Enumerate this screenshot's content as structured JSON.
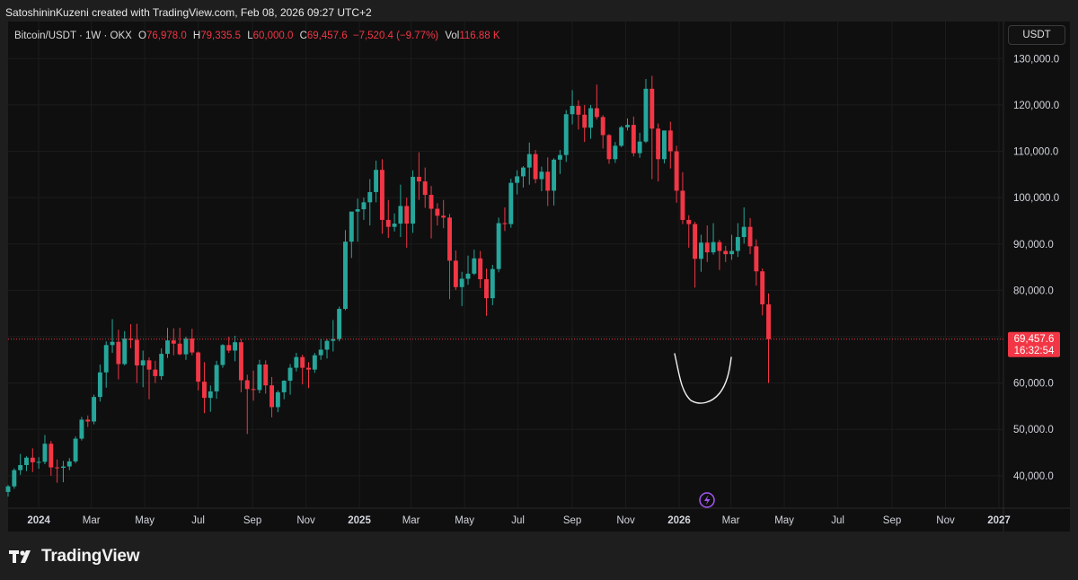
{
  "header": {
    "attribution": "SatoshininKuzeni created with TradingView.com, Feb 08, 2026 09:27 UTC+2"
  },
  "legend": {
    "symbol": "Bitcoin/USDT · 1W · OKX",
    "o_label": "O",
    "o_value": "76,978.0",
    "h_label": "H",
    "h_value": "79,335.5",
    "l_label": "L",
    "l_value": "60,000.0",
    "c_label": "C",
    "c_value": "69,457.6",
    "change": "−7,520.4 (−9.77%)",
    "vol_label": "Vol",
    "vol_value": "116.88 K"
  },
  "currency_button": "USDT",
  "price_tag": {
    "price": "69,457.6",
    "countdown": "16:32:54"
  },
  "footer": {
    "brand": "TradingView"
  },
  "colors": {
    "up": "#26a69a",
    "down": "#f23645",
    "text": "#d1d4dc",
    "grid": "#1c1c1c"
  },
  "chart_data": {
    "type": "candlestick",
    "ylim": [
      33000,
      138000
    ],
    "y_ticks": [
      {
        "value": 40000,
        "label": "40,000.0"
      },
      {
        "value": 50000,
        "label": "50,000.0"
      },
      {
        "value": 60000,
        "label": "60,000.0"
      },
      {
        "value": 70000,
        "label": "70,000.0"
      },
      {
        "value": 80000,
        "label": "80,000.0"
      },
      {
        "value": 90000,
        "label": "90,000.0"
      },
      {
        "value": 100000,
        "label": "100,000.0"
      },
      {
        "value": 110000,
        "label": "110,000.0"
      },
      {
        "value": 120000,
        "label": "120,000.0"
      },
      {
        "value": 130000,
        "label": "130,000.0"
      }
    ],
    "x_ticks": [
      {
        "date": "2024-01-01",
        "label": "2024",
        "bold": true
      },
      {
        "date": "2024-03-01",
        "label": "Mar"
      },
      {
        "date": "2024-05-01",
        "label": "May"
      },
      {
        "date": "2024-07-01",
        "label": "Jul"
      },
      {
        "date": "2024-09-01",
        "label": "Sep"
      },
      {
        "date": "2024-11-01",
        "label": "Nov"
      },
      {
        "date": "2025-01-01",
        "label": "2025",
        "bold": true
      },
      {
        "date": "2025-03-01",
        "label": "Mar"
      },
      {
        "date": "2025-05-01",
        "label": "May"
      },
      {
        "date": "2025-07-01",
        "label": "Jul"
      },
      {
        "date": "2025-09-01",
        "label": "Sep"
      },
      {
        "date": "2025-11-01",
        "label": "Nov"
      },
      {
        "date": "2026-01-01",
        "label": "2026",
        "bold": true
      },
      {
        "date": "2026-03-01",
        "label": "Mar"
      },
      {
        "date": "2026-05-01",
        "label": "May"
      },
      {
        "date": "2026-07-01",
        "label": "Jul"
      },
      {
        "date": "2026-09-01",
        "label": "Sep"
      },
      {
        "date": "2026-11-01",
        "label": "Nov"
      },
      {
        "date": "2027-01-01",
        "label": "2027",
        "bold": true
      }
    ],
    "first_week": "2023-11-27",
    "current_price": 69457.6,
    "ohlc": [
      [
        36500,
        38000,
        35500,
        37700
      ],
      [
        37700,
        41600,
        37200,
        41200
      ],
      [
        41200,
        44700,
        40200,
        42300
      ],
      [
        42300,
        44200,
        41000,
        43900
      ],
      [
        43900,
        45900,
        40800,
        42900
      ],
      [
        42900,
        44000,
        41500,
        43000
      ],
      [
        43000,
        48800,
        42500,
        46900
      ],
      [
        46900,
        47500,
        40000,
        41800
      ],
      [
        41800,
        43500,
        38500,
        41700
      ],
      [
        41700,
        43200,
        38600,
        42000
      ],
      [
        42000,
        43800,
        41200,
        43100
      ],
      [
        43100,
        48500,
        42700,
        48000
      ],
      [
        48000,
        52700,
        47600,
        52100
      ],
      [
        52100,
        53000,
        50500,
        51700
      ],
      [
        51700,
        57500,
        51100,
        57000
      ],
      [
        57000,
        64000,
        56000,
        62300
      ],
      [
        62300,
        69000,
        59000,
        68200
      ],
      [
        68200,
        73800,
        66500,
        68900
      ],
      [
        68900,
        71500,
        60800,
        64100
      ],
      [
        64100,
        71200,
        63800,
        69600
      ],
      [
        69600,
        72700,
        67500,
        69300
      ],
      [
        69300,
        72800,
        60000,
        63800
      ],
      [
        63800,
        67000,
        59100,
        64900
      ],
      [
        64900,
        65500,
        56500,
        62900
      ],
      [
        62900,
        64800,
        60000,
        61500
      ],
      [
        61500,
        67500,
        60700,
        66300
      ],
      [
        66300,
        71900,
        65400,
        69200
      ],
      [
        69200,
        71800,
        66000,
        68500
      ],
      [
        68500,
        71900,
        66000,
        66200
      ],
      [
        66200,
        70000,
        65000,
        69600
      ],
      [
        69600,
        71700,
        66000,
        66600
      ],
      [
        66600,
        66800,
        58400,
        60300
      ],
      [
        60300,
        64500,
        53500,
        56800
      ],
      [
        56800,
        59500,
        53800,
        58200
      ],
      [
        58200,
        64800,
        56600,
        63900
      ],
      [
        63900,
        68400,
        63300,
        68200
      ],
      [
        68200,
        70000,
        66500,
        67000
      ],
      [
        67000,
        70200,
        64700,
        68800
      ],
      [
        68800,
        69500,
        58000,
        60600
      ],
      [
        60600,
        61800,
        49000,
        58700
      ],
      [
        58700,
        62700,
        56200,
        58500
      ],
      [
        58500,
        65000,
        57800,
        64000
      ],
      [
        64000,
        64900,
        57700,
        59500
      ],
      [
        59500,
        61300,
        52600,
        54800
      ],
      [
        54800,
        58400,
        53700,
        58000
      ],
      [
        58000,
        60600,
        56500,
        60500
      ],
      [
        60500,
        64100,
        57500,
        63300
      ],
      [
        63300,
        66500,
        62500,
        65600
      ],
      [
        65600,
        66100,
        59700,
        63300
      ],
      [
        63300,
        64500,
        58900,
        62900
      ],
      [
        62900,
        66500,
        62200,
        66000
      ],
      [
        66000,
        69500,
        65000,
        67200
      ],
      [
        67200,
        69500,
        65300,
        69100
      ],
      [
        69100,
        73600,
        66800,
        69500
      ],
      [
        69500,
        76500,
        69000,
        76000
      ],
      [
        76000,
        93000,
        75700,
        90500
      ],
      [
        90500,
        94000,
        87000,
        97000
      ],
      [
        97000,
        99800,
        90500,
        97500
      ],
      [
        97500,
        100000,
        95200,
        99000
      ],
      [
        99000,
        104000,
        94000,
        101200
      ],
      [
        101200,
        108000,
        99000,
        106000
      ],
      [
        106000,
        108300,
        92200,
        95200
      ],
      [
        95200,
        99500,
        91300,
        93700
      ],
      [
        93700,
        96600,
        92700,
        94400
      ],
      [
        94400,
        102800,
        91500,
        98200
      ],
      [
        98200,
        100000,
        89200,
        94400
      ],
      [
        94400,
        105900,
        92400,
        104500
      ],
      [
        104500,
        109800,
        99500,
        103500
      ],
      [
        103500,
        106500,
        97800,
        100600
      ],
      [
        100600,
        102500,
        91200,
        97600
      ],
      [
        97600,
        98800,
        94000,
        96100
      ],
      [
        96100,
        99500,
        93400,
        95700
      ],
      [
        95700,
        96500,
        78100,
        86400
      ],
      [
        86400,
        88600,
        80100,
        80700
      ],
      [
        80700,
        84000,
        76600,
        82500
      ],
      [
        82500,
        87500,
        81200,
        83600
      ],
      [
        83600,
        88800,
        83300,
        86900
      ],
      [
        86900,
        88500,
        80500,
        82400
      ],
      [
        82400,
        84700,
        74500,
        78300
      ],
      [
        78300,
        85500,
        76800,
        84600
      ],
      [
        84600,
        95700,
        83900,
        94500
      ],
      [
        94500,
        97900,
        92800,
        94300
      ],
      [
        94300,
        104100,
        93500,
        103200
      ],
      [
        103200,
        105900,
        100700,
        104600
      ],
      [
        104600,
        106800,
        102200,
        106500
      ],
      [
        106500,
        111900,
        102800,
        109400
      ],
      [
        109400,
        110300,
        103100,
        104000
      ],
      [
        104000,
        106700,
        101400,
        105600
      ],
      [
        105600,
        108700,
        98200,
        101500
      ],
      [
        101500,
        108500,
        98300,
        108200
      ],
      [
        108200,
        110300,
        105100,
        109200
      ],
      [
        109200,
        118900,
        107700,
        118000
      ],
      [
        118000,
        123200,
        115800,
        119800
      ],
      [
        119800,
        121000,
        114700,
        117900
      ],
      [
        117900,
        120000,
        112000,
        115100
      ],
      [
        115100,
        120000,
        112700,
        119300
      ],
      [
        119300,
        124400,
        116900,
        117400
      ],
      [
        117400,
        117800,
        110600,
        113500
      ],
      [
        113500,
        113700,
        107300,
        108300
      ],
      [
        108300,
        112000,
        107500,
        111200
      ],
      [
        111200,
        115500,
        110900,
        115200
      ],
      [
        115200,
        117100,
        114500,
        115700
      ],
      [
        115700,
        117500,
        108900,
        109600
      ],
      [
        109600,
        114000,
        108600,
        112100
      ],
      [
        112100,
        125600,
        111800,
        123500
      ],
      [
        123500,
        126300,
        104000,
        114900
      ],
      [
        114900,
        116000,
        103500,
        108300
      ],
      [
        108300,
        114000,
        107400,
        114500
      ],
      [
        114500,
        116400,
        106300,
        110000
      ],
      [
        110000,
        111200,
        98900,
        101500
      ],
      [
        101500,
        105500,
        94300,
        95200
      ],
      [
        95200,
        96200,
        89200,
        94300
      ],
      [
        94300,
        94800,
        80600,
        86800
      ],
      [
        86800,
        92000,
        84000,
        90300
      ],
      [
        90300,
        94000,
        86100,
        88200
      ],
      [
        88200,
        94500,
        87700,
        90400
      ],
      [
        90400,
        90900,
        84400,
        88500
      ],
      [
        88500,
        89600,
        86100,
        87800
      ],
      [
        87800,
        92000,
        86600,
        88500
      ],
      [
        88500,
        94500,
        87200,
        91500
      ],
      [
        91500,
        97900,
        90100,
        93700
      ],
      [
        93700,
        95600,
        87800,
        89500
      ],
      [
        89500,
        91000,
        81000,
        84100
      ],
      [
        84100,
        84700,
        74600,
        76978
      ],
      [
        76978,
        79335.5,
        60000,
        69457.6
      ]
    ]
  }
}
